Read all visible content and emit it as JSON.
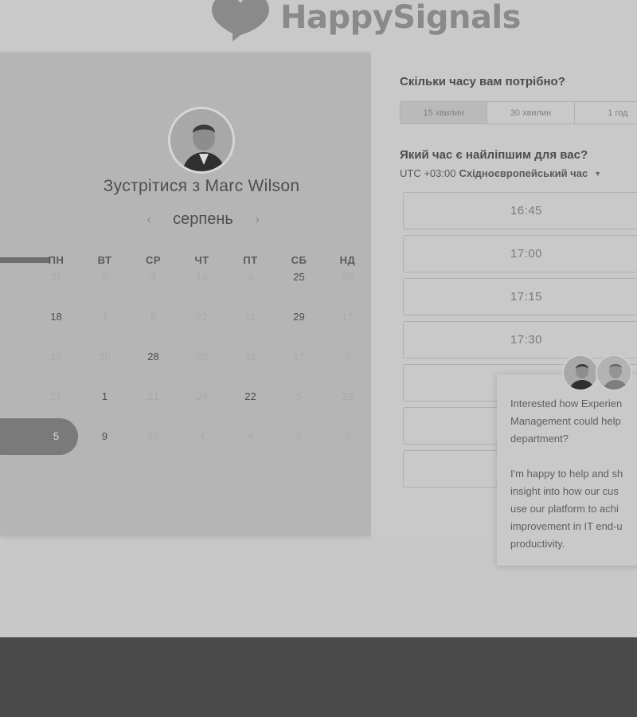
{
  "brand": {
    "name": "HappySignals"
  },
  "calendar": {
    "title": "Зустрітися з Marc Wilson",
    "month": "серпень",
    "prev_icon": "chevron-left-icon",
    "next_icon": "chevron-right-icon",
    "weekdays": [
      "ПН",
      "ВТ",
      "СР",
      "ЧТ",
      "ПТ",
      "СБ",
      "НД"
    ],
    "weeks": [
      [
        {
          "d": "31",
          "on": false
        },
        {
          "d": "8",
          "on": false
        },
        {
          "d": "4",
          "on": false
        },
        {
          "d": "10",
          "on": false
        },
        {
          "d": "4",
          "on": false
        },
        {
          "d": "25",
          "on": true
        },
        {
          "d": "26",
          "on": false
        }
      ],
      [
        {
          "d": "18",
          "on": true
        },
        {
          "d": "1",
          "on": false
        },
        {
          "d": "8",
          "on": false
        },
        {
          "d": "22",
          "on": false
        },
        {
          "d": "11",
          "on": false
        },
        {
          "d": "29",
          "on": true
        },
        {
          "d": "17",
          "on": false
        }
      ],
      [
        {
          "d": "10",
          "on": false
        },
        {
          "d": "20",
          "on": false
        },
        {
          "d": "28",
          "on": true
        },
        {
          "d": "20",
          "on": false
        },
        {
          "d": "31",
          "on": false
        },
        {
          "d": "17",
          "on": false
        },
        {
          "d": "5",
          "on": false
        }
      ],
      [
        {
          "d": "27",
          "on": false
        },
        {
          "d": "1",
          "on": true
        },
        {
          "d": "21",
          "on": false
        },
        {
          "d": "24",
          "on": false
        },
        {
          "d": "22",
          "on": true
        },
        {
          "d": "5",
          "on": false
        },
        {
          "d": "23",
          "on": false
        }
      ],
      [
        {
          "d": "5",
          "on": true
        },
        {
          "d": "9",
          "on": true
        },
        {
          "d": "18",
          "on": false
        },
        {
          "d": "4",
          "on": false
        },
        {
          "d": "4",
          "on": false
        },
        {
          "d": "5",
          "on": false
        },
        {
          "d": "6",
          "on": false
        }
      ]
    ],
    "selected_day": "5"
  },
  "scheduler": {
    "duration_question": "Скільки часу вам потрібно?",
    "durations": [
      "15 хвилин",
      "30 хвилин",
      "1 год"
    ],
    "active_duration": "15 хвилин",
    "time_question": "Який час є найліпшим для вас?",
    "timezone_offset": "UTC +03:00",
    "timezone_name": "Східноєвропейський час",
    "slots": [
      "16:45",
      "17:00",
      "17:15",
      "17:30",
      "",
      "",
      ""
    ]
  },
  "chat": {
    "message": "Interested how Experien\nManagement could help\ndepartment?\n\nI'm happy to help and sh\ninsight into how our cus\nuse our platform to achi\nimprovement in IT end-u\nproductivity."
  },
  "colors": {
    "overlay_bg": "#c8c8c8",
    "calendar_bg": "#b5b5b5",
    "selected": "#7a7a7a",
    "footer": "#4a4a4a"
  }
}
